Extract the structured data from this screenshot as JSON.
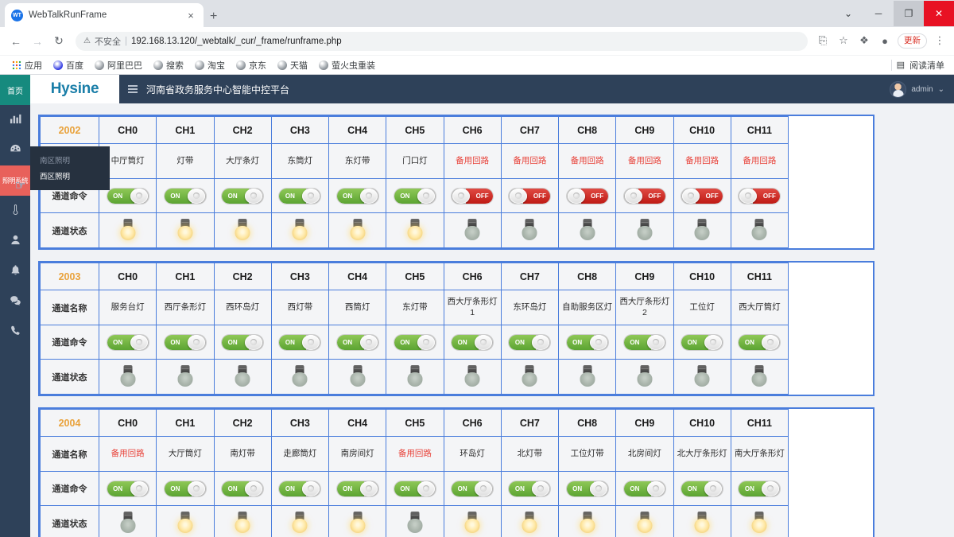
{
  "browser": {
    "tab_title": "WebTalkRunFrame",
    "tab_favicon_text": "WT",
    "tab_close": "×",
    "new_tab": "+",
    "back": "←",
    "forward": "→",
    "reload": "↻",
    "security_icon": "⚠",
    "security_text": "不安全",
    "separator": "|",
    "url": "192.168.13.120/_webtalk/_cur/_frame/runframe.php",
    "share_icon": "⎘",
    "star_icon": "☆",
    "extensions_icon": "❖",
    "profile_icon": "●",
    "update_label": "更新",
    "menu_icon": "⋮",
    "minimize": "─",
    "restore": "❐",
    "close": "✕",
    "bookmarks": [
      {
        "label": "应用",
        "icon": "apps-grid-icon"
      },
      {
        "label": "百度",
        "icon": "baidu-icon"
      },
      {
        "label": "阿里巴巴",
        "icon": "globe-icon"
      },
      {
        "label": "搜索",
        "icon": "globe-icon"
      },
      {
        "label": "淘宝",
        "icon": "globe-icon"
      },
      {
        "label": "京东",
        "icon": "globe-icon"
      },
      {
        "label": "天猫",
        "icon": "globe-icon"
      },
      {
        "label": "萤火虫重装",
        "icon": "globe-icon"
      }
    ],
    "reading_list_icon": "▤",
    "reading_list_label": "阅读清单"
  },
  "app": {
    "logo": "Hysine",
    "title": "河南省政务服务中心智能中控平台",
    "username": "admin",
    "user_caret": "⌄",
    "accent_color": "#4a7ddc",
    "sidebar_bg": "#2e4159",
    "active_color": "#e8615b"
  },
  "sidebar": {
    "items": [
      {
        "label": "首页",
        "icon": "home-text-icon",
        "type": "text",
        "state": "home"
      },
      {
        "label": "统计图表",
        "icon": "bar-chart-icon",
        "type": "icon",
        "state": ""
      },
      {
        "label": "监控仪表",
        "icon": "dashboard-icon",
        "type": "icon",
        "state": ""
      },
      {
        "label": "照明系统",
        "icon": "lighting-text-icon",
        "type": "text",
        "state": "active"
      },
      {
        "label": "温控",
        "icon": "thermometer-icon",
        "type": "icon",
        "state": ""
      },
      {
        "label": "用户",
        "icon": "user-icon",
        "type": "icon",
        "state": ""
      },
      {
        "label": "告警",
        "icon": "bell-icon",
        "type": "icon",
        "state": ""
      },
      {
        "label": "消息",
        "icon": "chat-icon",
        "type": "icon",
        "state": ""
      },
      {
        "label": "电话",
        "icon": "phone-icon",
        "type": "icon",
        "state": ""
      }
    ],
    "flyout": [
      {
        "label": "南区照明",
        "highlight": false
      },
      {
        "label": "西区照明",
        "highlight": true
      }
    ],
    "cursor_icon": "pointer-hand-icon"
  },
  "row_labels": {
    "name": "通道名称",
    "command": "通道命令",
    "status": "通道状态"
  },
  "switch_labels": {
    "on": "ON",
    "off": "OFF"
  },
  "channel_headers": [
    "CH0",
    "CH1",
    "CH2",
    "CH3",
    "CH4",
    "CH5",
    "CH6",
    "CH7",
    "CH8",
    "CH9",
    "CH10",
    "CH11"
  ],
  "blocks": [
    {
      "device_id": "2002",
      "names": [
        "中厅筒灯",
        "灯带",
        "大厅条灯",
        "东筒灯",
        "东灯带",
        "门口灯",
        "备用回路",
        "备用回路",
        "备用回路",
        "备用回路",
        "备用回路",
        "备用回路"
      ],
      "spare": [
        false,
        false,
        false,
        false,
        false,
        false,
        true,
        true,
        true,
        true,
        true,
        true
      ],
      "commands": [
        "on",
        "on",
        "on",
        "on",
        "on",
        "on",
        "off",
        "off",
        "off",
        "off",
        "off",
        "off"
      ],
      "status": [
        "on",
        "on",
        "on",
        "on",
        "on",
        "on",
        "off",
        "off",
        "off",
        "off",
        "off",
        "off"
      ]
    },
    {
      "device_id": "2003",
      "names": [
        "服务台灯",
        "西厅条形灯",
        "西环岛灯",
        "西灯带",
        "西筒灯",
        "东灯带",
        "西大厅条形灯1",
        "东环岛灯",
        "自助服务区灯",
        "西大厅条形灯2",
        "工位灯",
        "西大厅筒灯"
      ],
      "spare": [
        false,
        false,
        false,
        false,
        false,
        false,
        false,
        false,
        false,
        false,
        false,
        false
      ],
      "commands": [
        "on",
        "on",
        "on",
        "on",
        "on",
        "on",
        "on",
        "on",
        "on",
        "on",
        "on",
        "on"
      ],
      "status": [
        "off",
        "off",
        "off",
        "off",
        "off",
        "off",
        "off",
        "off",
        "off",
        "off",
        "off",
        "off"
      ]
    },
    {
      "device_id": "2004",
      "names": [
        "备用回路",
        "大厅筒灯",
        "南灯带",
        "走廊筒灯",
        "南房间灯",
        "备用回路",
        "环岛灯",
        "北灯带",
        "工位灯带",
        "北房间灯",
        "北大厅条形灯",
        "南大厅条形灯"
      ],
      "spare": [
        true,
        false,
        false,
        false,
        false,
        true,
        false,
        false,
        false,
        false,
        false,
        false
      ],
      "commands": [
        "on",
        "on",
        "on",
        "on",
        "on",
        "on",
        "on",
        "on",
        "on",
        "on",
        "on",
        "on"
      ],
      "status": [
        "off",
        "on",
        "on",
        "on",
        "on",
        "off",
        "on",
        "on",
        "on",
        "on",
        "on",
        "on"
      ]
    }
  ]
}
